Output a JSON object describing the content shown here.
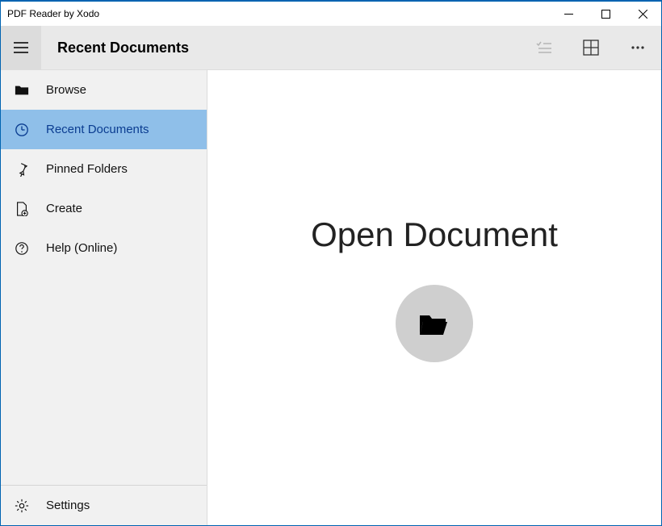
{
  "window": {
    "title": "PDF Reader by Xodo"
  },
  "header": {
    "title": "Recent Documents"
  },
  "sidebar": {
    "items": [
      {
        "label": "Browse"
      },
      {
        "label": "Recent Documents"
      },
      {
        "label": "Pinned Folders"
      },
      {
        "label": "Create"
      },
      {
        "label": "Help (Online)"
      }
    ],
    "footer": {
      "settings_label": "Settings"
    }
  },
  "main": {
    "open_heading": "Open Document"
  }
}
